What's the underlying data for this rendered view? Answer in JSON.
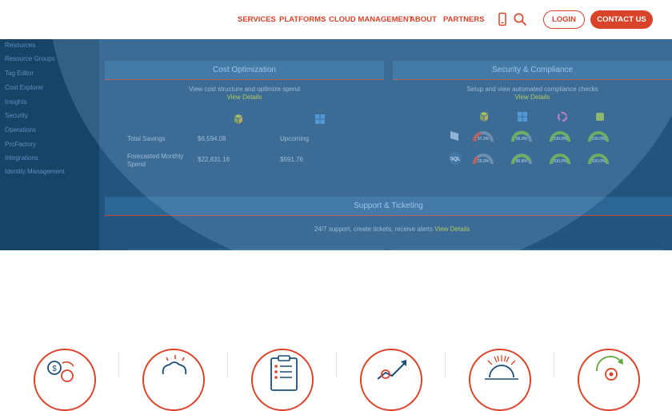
{
  "nav": {
    "items": [
      "SERVICES",
      "PLATFORMS",
      "CLOUD MANAGEMENT",
      "ABOUT",
      "PARTNERS"
    ],
    "login_label": "LOGIN",
    "contact_label": "CONTACT US",
    "icons": [
      "mobile-icon",
      "search-icon"
    ],
    "accent": "#d9432a"
  },
  "hero": {
    "sidebar_items": [
      "Resources",
      "Resource Groups",
      "Tag Editor",
      "Cost Explorer",
      "Insights",
      "Security",
      "Operations",
      "ProFactory",
      "Integrations",
      "Identity Management"
    ],
    "cost_panel": {
      "title": "Cost Optimization",
      "subtitle": "View cost structure and optimize spend",
      "link": "View Details",
      "rows": [
        {
          "label": "Total Savings",
          "value": "$6,594.08",
          "upcoming": "Upcoming"
        },
        {
          "label": "Forecasted Monthly Spend",
          "value": "$22,831.16",
          "upcoming": "$591.76"
        }
      ]
    },
    "security_panel": {
      "title": "Security & Compliance",
      "subtitle": "Setup and view automated compliance checks",
      "link": "View Details",
      "gauges_row1": [
        "37.3%",
        "66.9%",
        "100.0%",
        "100.0%"
      ],
      "gauges_row2": [
        "25.0%",
        "86.8%",
        "100.0%",
        "100.0%"
      ]
    },
    "support_panel": {
      "title": "Support & Ticketing",
      "subtitle": "24/7 support, create tickets, receive alerts",
      "link": "View Details"
    }
  },
  "features": [
    "money-gear-icon",
    "brain-icon",
    "checklist-icon",
    "growth-chart-icon",
    "sunrise-icon",
    "cycle-gear-icon"
  ]
}
